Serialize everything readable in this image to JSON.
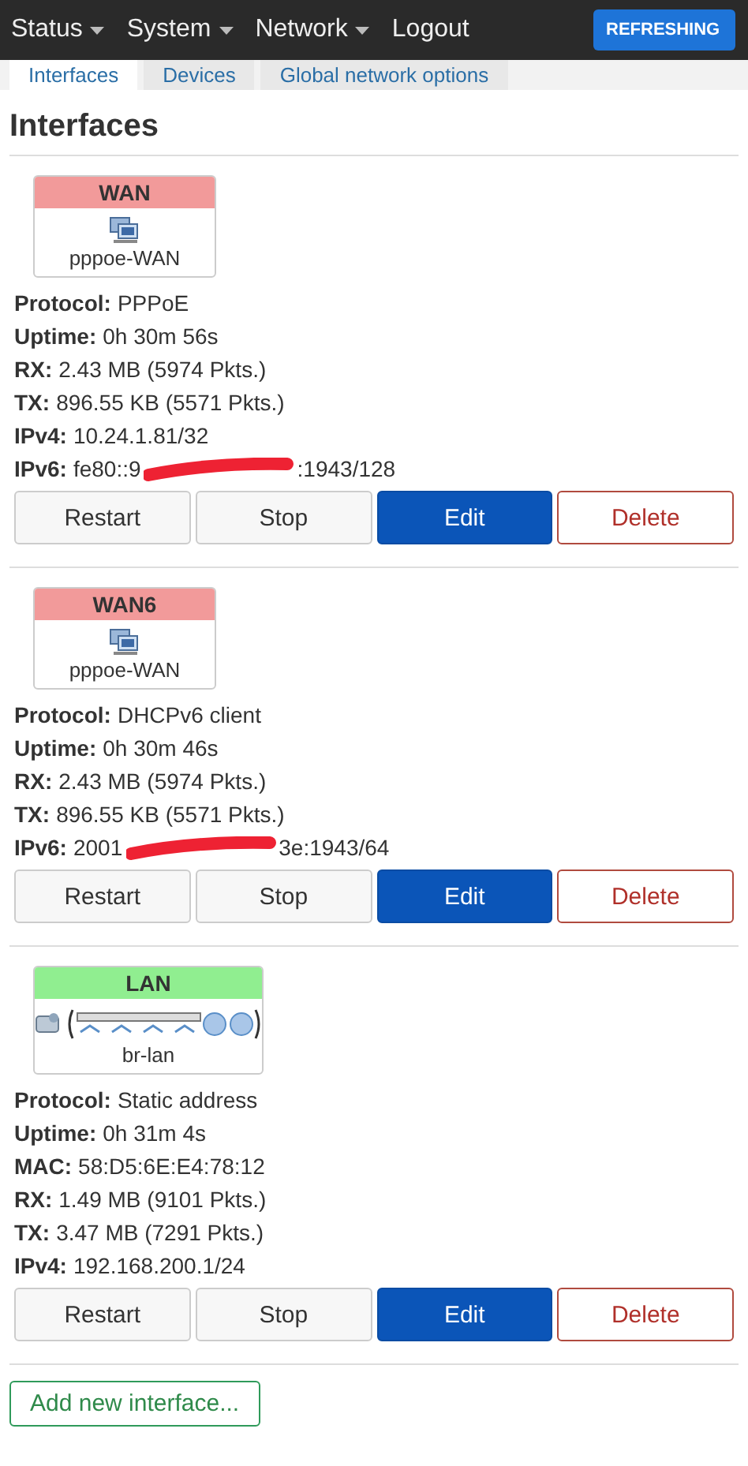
{
  "navbar": {
    "menus": [
      {
        "label": "Status",
        "dropdown": true
      },
      {
        "label": "System",
        "dropdown": true
      },
      {
        "label": "Network",
        "dropdown": true
      },
      {
        "label": "Logout",
        "dropdown": false
      }
    ],
    "indicator": "REFRESHING"
  },
  "tabs": [
    {
      "label": "Interfaces",
      "selected": true
    },
    {
      "label": "Devices",
      "selected": false
    },
    {
      "label": "Global network options",
      "selected": false
    }
  ],
  "heading": "Interfaces",
  "interfaces": [
    {
      "name": "WAN",
      "color": "#f29a9a",
      "kind": "single",
      "device": "pppoe-WAN",
      "details": [
        {
          "label": "Protocol:",
          "value": "PPPoE"
        },
        {
          "label": "Uptime:",
          "value": "0h 30m 56s"
        },
        {
          "label": "RX:",
          "value": "2.43 MB (5974 Pkts.)"
        },
        {
          "label": "TX:",
          "value": "896.55 KB (5571 Pkts.)"
        },
        {
          "label": "IPv4:",
          "value": "10.24.1.81/32"
        },
        {
          "label": "IPv6:",
          "value": "fe80::9",
          "redacted": true,
          "value_end": ":1943/128"
        }
      ],
      "buttons": [
        {
          "label": "Restart",
          "kind": "plain"
        },
        {
          "label": "Stop",
          "kind": "plain"
        },
        {
          "label": "Edit",
          "kind": "primary"
        },
        {
          "label": "Delete",
          "kind": "danger"
        }
      ]
    },
    {
      "name": "WAN6",
      "color": "#f29a9a",
      "kind": "single",
      "device": "pppoe-WAN",
      "details": [
        {
          "label": "Protocol:",
          "value": "DHCPv6 client"
        },
        {
          "label": "Uptime:",
          "value": "0h 30m 46s"
        },
        {
          "label": "RX:",
          "value": "2.43 MB (5974 Pkts.)"
        },
        {
          "label": "TX:",
          "value": "896.55 KB (5571 Pkts.)"
        },
        {
          "label": "IPv6:",
          "value": "2001",
          "redacted": true,
          "value_end": "3e:1943/64"
        }
      ],
      "buttons": [
        {
          "label": "Restart",
          "kind": "plain"
        },
        {
          "label": "Stop",
          "kind": "plain"
        },
        {
          "label": "Edit",
          "kind": "primary"
        },
        {
          "label": "Delete",
          "kind": "danger"
        }
      ]
    },
    {
      "name": "LAN",
      "color": "#90ee90",
      "kind": "bridge",
      "device": "br-lan",
      "details": [
        {
          "label": "Protocol:",
          "value": "Static address"
        },
        {
          "label": "Uptime:",
          "value": "0h 31m 4s"
        },
        {
          "label": "MAC:",
          "value": "58:D5:6E:E4:78:12"
        },
        {
          "label": "RX:",
          "value": "1.49 MB (9101 Pkts.)"
        },
        {
          "label": "TX:",
          "value": "3.47 MB (7291 Pkts.)"
        },
        {
          "label": "IPv4:",
          "value": "192.168.200.1/24"
        }
      ],
      "buttons": [
        {
          "label": "Restart",
          "kind": "plain"
        },
        {
          "label": "Stop",
          "kind": "plain"
        },
        {
          "label": "Edit",
          "kind": "primary"
        },
        {
          "label": "Delete",
          "kind": "danger"
        }
      ]
    }
  ],
  "add_button": "Add new interface..."
}
